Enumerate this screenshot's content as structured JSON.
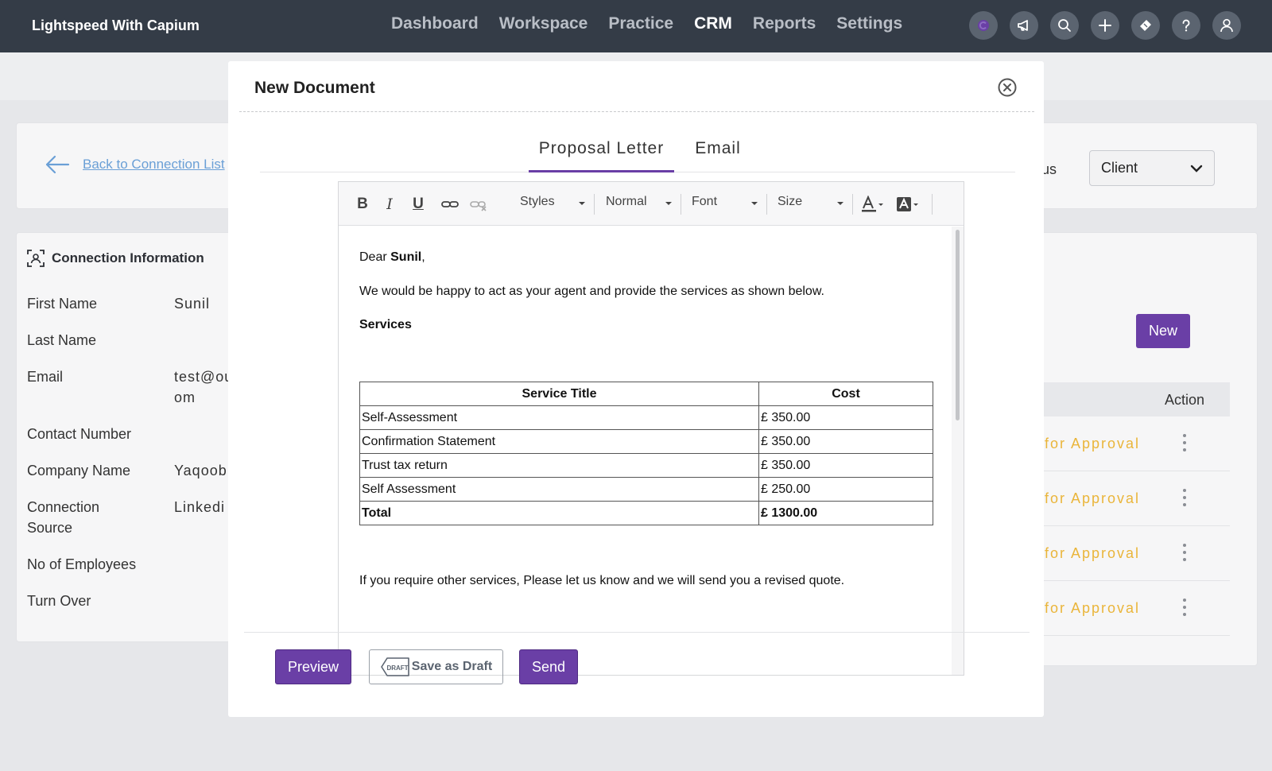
{
  "app": {
    "brand": "Lightspeed With Capium",
    "nav": [
      "Dashboard",
      "Workspace",
      "Practice",
      "CRM",
      "Reports",
      "Settings"
    ],
    "active_nav": "CRM",
    "top_icons": [
      "capium-icon",
      "megaphone-icon",
      "search-icon",
      "plus-icon",
      "ticket-icon",
      "help-icon",
      "user-icon"
    ]
  },
  "background": {
    "back_link": "Back to Connection List",
    "status_label": "us",
    "client_select": "Client",
    "connection_info": {
      "title": "Connection Information",
      "rows": [
        {
          "label": "First Name",
          "value": "Sunil"
        },
        {
          "label": "Last Name",
          "value": ""
        },
        {
          "label": "Email",
          "value": "test@ou",
          "value2": "om"
        },
        {
          "label": "Contact Number",
          "value": ""
        },
        {
          "label": "Company Name",
          "value": "Yaqoob"
        },
        {
          "label": "Connection",
          "label2": "Source",
          "value": "Linkedi"
        },
        {
          "label": "No of Employees",
          "value": ""
        },
        {
          "label": "Turn Over",
          "value": ""
        }
      ]
    },
    "new_button": "New",
    "action_header": "Action",
    "status_rows": [
      "for Approval",
      "for Approval",
      "for Approval",
      "for Approval"
    ]
  },
  "modal": {
    "title": "New Document",
    "tabs": [
      "Proposal Letter",
      "Email"
    ],
    "active_tab": "Proposal Letter",
    "toolbar": {
      "styles": "Styles",
      "format": "Normal",
      "font": "Font",
      "size": "Size"
    },
    "letter": {
      "greeting_prefix": "Dear ",
      "name": "Sunil",
      "greeting_suffix": ",",
      "intro": "We would be happy to act as your agent and provide the services as shown below.",
      "services_heading": "Services",
      "table_headers": [
        "Service Title",
        "Cost"
      ],
      "services": [
        {
          "title": "Self-Assessment",
          "cost": "£ 350.00"
        },
        {
          "title": "Confirmation Statement",
          "cost": "£ 350.00"
        },
        {
          "title": "Trust tax return",
          "cost": "£ 350.00"
        },
        {
          "title": "Self Assessment",
          "cost": "£ 250.00"
        }
      ],
      "total_label": "Total",
      "total_cost": "£ 1300.00",
      "closing": "If you require other services, Please let us know and we will send you a revised quote."
    },
    "buttons": {
      "preview": "Preview",
      "draft": "Save as Draft",
      "draft_tag": "DRAFT",
      "send": "Send"
    }
  },
  "colors": {
    "topbar": "#343c47",
    "accent": "#6a3fa6",
    "status": "#eab53a",
    "link": "#6a9fd6"
  }
}
